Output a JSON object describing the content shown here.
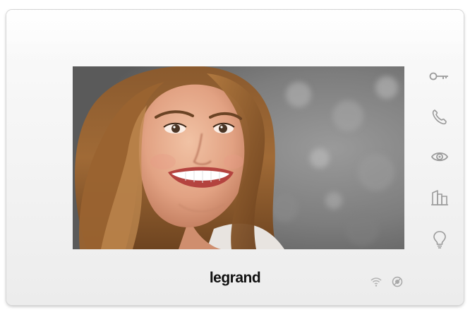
{
  "device": {
    "brand": "legrand",
    "accent_color": "#9b9b9b",
    "frame_color": "#f4f4f4"
  },
  "screen": {
    "content": "video-feed"
  },
  "side_buttons": [
    {
      "icon": "key-icon",
      "action": "door-unlock"
    },
    {
      "icon": "phone-handset-icon",
      "action": "answer-call"
    },
    {
      "icon": "eye-icon",
      "action": "monitor"
    },
    {
      "icon": "building-icon",
      "action": "intercom"
    },
    {
      "icon": "light-bulb-icon",
      "action": "lights"
    }
  ],
  "status_indicators": [
    {
      "icon": "wifi-icon"
    },
    {
      "icon": "do-not-disturb-icon"
    }
  ]
}
